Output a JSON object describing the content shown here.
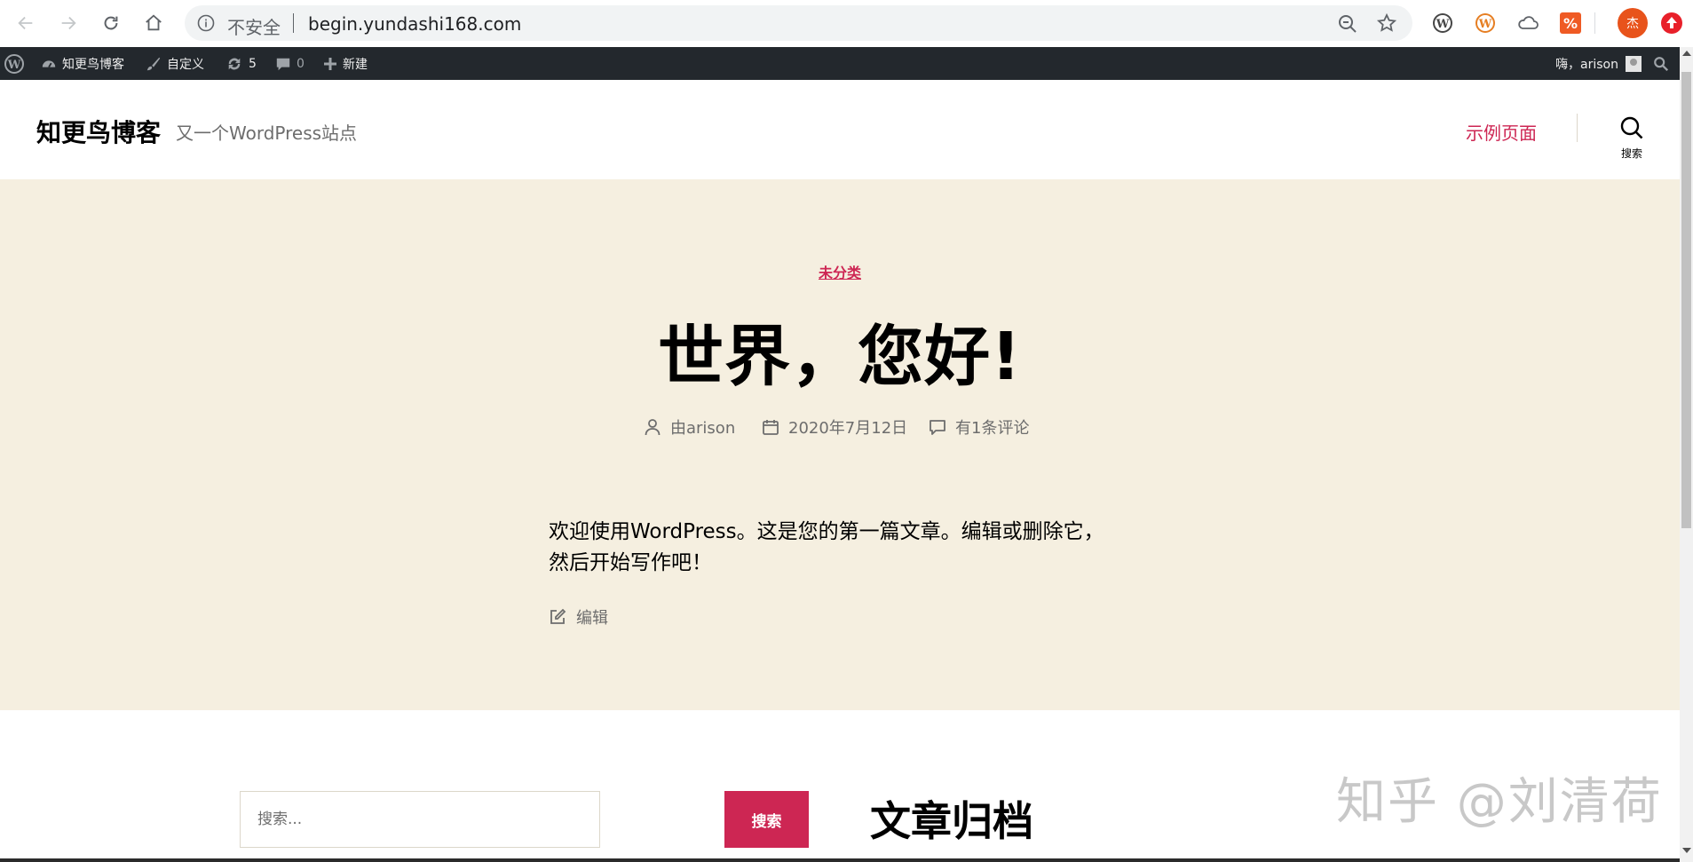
{
  "browser": {
    "security_label": "不安全",
    "url": "begin.yundashi168.com",
    "profile_initial": "杰"
  },
  "adminbar": {
    "site_name": "知更鸟博客",
    "customize": "自定义",
    "updates_count": "5",
    "comments_count": "0",
    "new_label": "新建",
    "greeting": "嗨，arison"
  },
  "header": {
    "site_title": "知更鸟博客",
    "site_description": "又一个WordPress站点",
    "menu_item": "示例页面",
    "search_label": "搜索"
  },
  "post": {
    "category": "未分类",
    "title": "世界，您好!",
    "author": "由arison",
    "date": "2020年7月12日",
    "comments": "有1条评论",
    "content": "欢迎使用WordPress。这是您的第一篇文章。编辑或删除它，然后开始写作吧！",
    "edit_label": "编辑"
  },
  "widgets": {
    "search_placeholder": "搜索...",
    "search_button": "搜索",
    "archive_title": "文章归档"
  },
  "watermark": "知乎 @刘清荷",
  "colors": {
    "accent": "#cd2653",
    "hero_bg": "#f5efe0",
    "adminbar_bg": "#23282d"
  }
}
